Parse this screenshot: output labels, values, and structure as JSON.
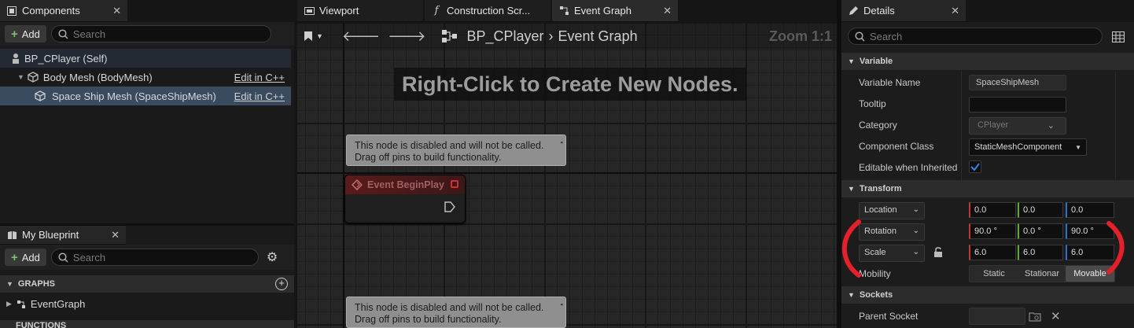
{
  "components_panel": {
    "tab_label": "Components",
    "add_label": "Add",
    "search_placeholder": "Search",
    "items": [
      {
        "label": "BP_CPlayer (Self)",
        "edit": ""
      },
      {
        "label": "Body Mesh (BodyMesh)",
        "edit": "Edit in C++"
      },
      {
        "label": "Space Ship Mesh (SpaceShipMesh)",
        "edit": "Edit in C++"
      }
    ]
  },
  "my_blueprint": {
    "tab_label": "My Blueprint",
    "add_label": "Add",
    "search_placeholder": "Search",
    "graphs_header": "GRAPHS",
    "graph_item": "EventGraph",
    "functions_header": "FUNCTIONS"
  },
  "editor_tabs": [
    {
      "label": "Viewport"
    },
    {
      "label": "Construction Scr..."
    },
    {
      "label": "Event Graph"
    }
  ],
  "graph": {
    "breadcrumb_blueprint": "BP_CPlayer",
    "breadcrumb_graph": "Event Graph",
    "zoom": "Zoom 1:1",
    "hint": "Right-Click to Create New Nodes.",
    "note_line1": "This node is disabled and will not be called.",
    "note_line2": "Drag off pins to build functionality.",
    "node_title": "Event BeginPlay"
  },
  "details": {
    "tab_label": "Details",
    "search_placeholder": "Search",
    "variable_header": "Variable",
    "variable_name_label": "Variable Name",
    "variable_name_value": "SpaceShipMesh",
    "tooltip_label": "Tooltip",
    "category_label": "Category",
    "category_value": "CPlayer",
    "component_class_label": "Component Class",
    "component_class_value": "StaticMeshComponent",
    "editable_label": "Editable when Inherited",
    "transform_header": "Transform",
    "location_label": "Location",
    "location": [
      "0.0",
      "0.0",
      "0.0"
    ],
    "rotation_label": "Rotation",
    "rotation": [
      "90.0 °",
      "0.0 °",
      "90.0 °"
    ],
    "scale_label": "Scale",
    "scale": [
      "6.0",
      "6.0",
      "6.0"
    ],
    "mobility_label": "Mobility",
    "mobility_options": [
      "Static",
      "Stationar",
      "Movable"
    ],
    "sockets_header": "Sockets",
    "parent_socket_label": "Parent Socket"
  },
  "colors": {
    "accent_red": "#e4202a",
    "selection": "#3a4a5f",
    "x_axis": "#c03a2b",
    "y_axis": "#5fa83a",
    "z_axis": "#2f6fd0"
  }
}
